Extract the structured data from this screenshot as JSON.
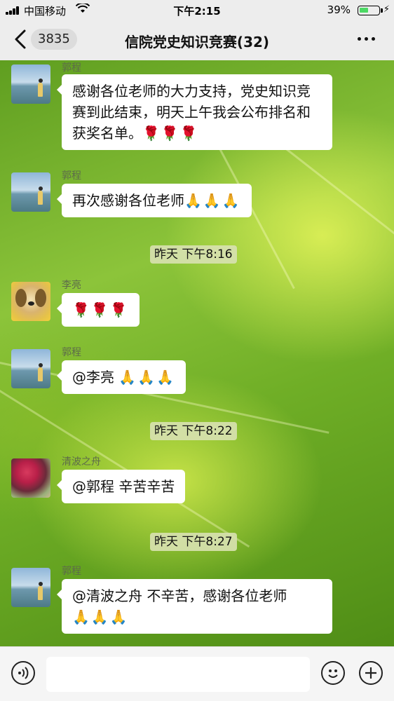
{
  "status_bar": {
    "carrier": "中国移动",
    "time": "下午2:15",
    "battery": "39%"
  },
  "nav": {
    "unread_count": "3835",
    "title": "信院党史知识竞赛(32)"
  },
  "messages": [
    {
      "sender": "郭程",
      "avatar": "sea-girl",
      "text": "感谢各位老师的大力支持，党史知识竞赛到此结束，明天上午我会公布排名和获奖名单。",
      "emoji": "🌹🌹🌹"
    },
    {
      "sender": "郭程",
      "avatar": "sea-girl",
      "text": "再次感谢各位老师",
      "emoji": "🙏🙏🙏"
    },
    {
      "timestamp": "昨天 下午8:16"
    },
    {
      "sender": "李亮",
      "avatar": "puppy",
      "text": "",
      "emoji": "🌹🌹🌹"
    },
    {
      "sender": "郭程",
      "avatar": "sea-girl",
      "text": "@李亮 ",
      "emoji": "🙏🙏🙏"
    },
    {
      "timestamp": "昨天 下午8:22"
    },
    {
      "sender": "清波之舟",
      "avatar": "roses",
      "text": "@郭程 辛苦辛苦",
      "emoji": ""
    },
    {
      "timestamp": "昨天 下午8:27"
    },
    {
      "sender": "郭程",
      "avatar": "sea-girl",
      "text": "@清波之舟 不辛苦，感谢各位老师",
      "emoji": "🙏🙏🙏"
    }
  ],
  "input": {
    "placeholder": ""
  },
  "colors": {
    "bubble": "#ffffff",
    "nav_bg": "#ededed",
    "battery": "#4cd964"
  }
}
